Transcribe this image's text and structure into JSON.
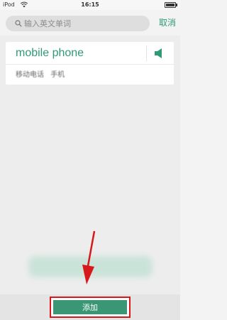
{
  "status_bar": {
    "carrier": "iPod",
    "time": "16:15"
  },
  "search": {
    "placeholder": "输入英文单词",
    "value": "",
    "cancel_label": "取消"
  },
  "word_card": {
    "headword": "mobile phone",
    "definitions": [
      "移动电话",
      "手机"
    ]
  },
  "bottom_bar": {
    "add_label": "添加"
  },
  "colors": {
    "accent": "#2e9a78",
    "add_button": "#3a9674",
    "highlight_frame": "#d7191c",
    "arrow": "#d7191c"
  }
}
